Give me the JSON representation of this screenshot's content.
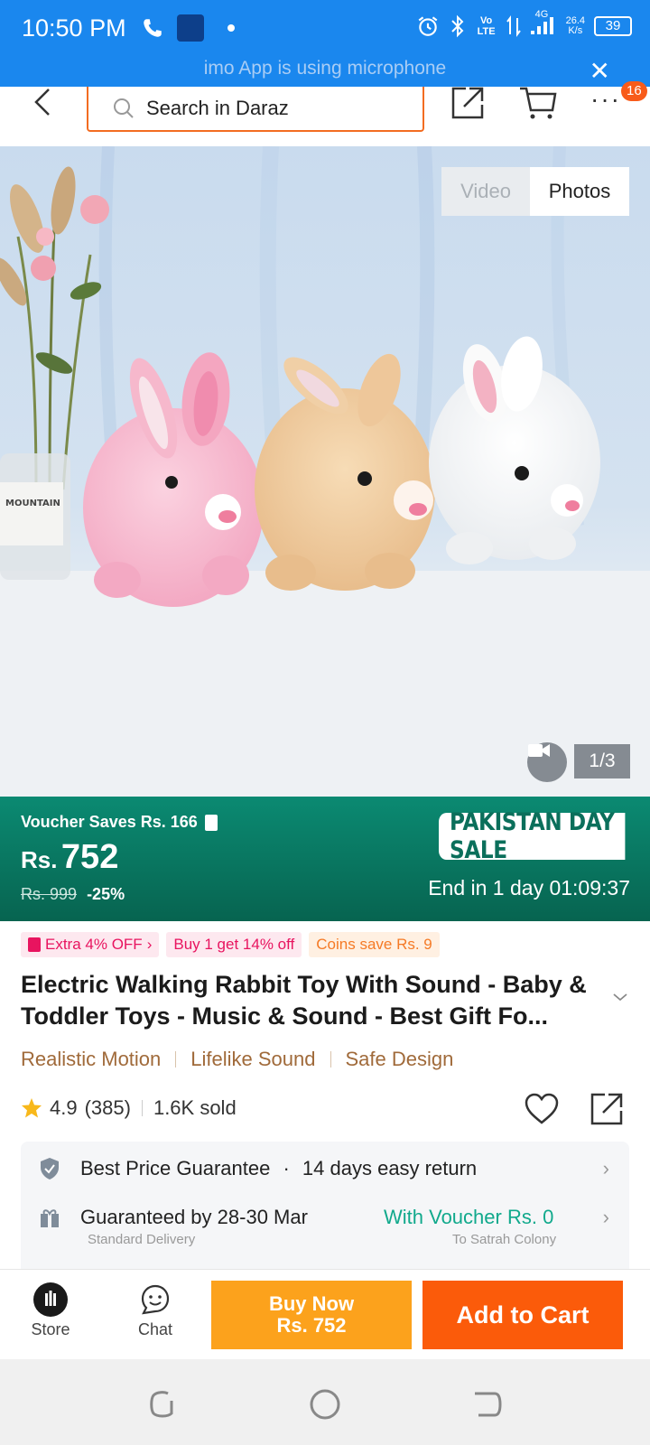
{
  "status_bar": {
    "time": "10:50 PM",
    "battery": "39",
    "network_speed_value": "26.4",
    "network_speed_unit": "K/s",
    "network_type": "4G",
    "volte": "Vo LTE",
    "notice": "imo App is using microphone"
  },
  "header": {
    "search_placeholder": "Search in Daraz",
    "notification_count": "16"
  },
  "gallery": {
    "video_label": "Video",
    "photos_label": "Photos",
    "counter": "1/3",
    "vase_label": "MOUNTAIN"
  },
  "banner": {
    "voucher_text": "Voucher Saves Rs. 166",
    "currency": "Rs.",
    "price": "752",
    "original_price": "Rs. 999",
    "discount": "-25%",
    "sale_name": "PAKISTAN DAY SALE",
    "end_text": "End in 1 day 01:09:37"
  },
  "promos": {
    "extra_off": "Extra 4% OFF",
    "buy_get": "Buy 1 get 14% off",
    "coins": "Coins save Rs. 9"
  },
  "product": {
    "title": "Electric Walking Rabbit Toy With Sound - Baby & Toddler Toys - Music & Sound - Best Gift Fo...",
    "features": [
      "Realistic Motion",
      "Lifelike Sound",
      "Safe Design"
    ],
    "rating": "4.9",
    "reviews": "(385)",
    "sold": "1.6K sold"
  },
  "info": {
    "guarantee": "Best Price Guarantee",
    "return_policy": "14 days easy return",
    "delivery": "Guaranteed by 28-30 Mar",
    "delivery_voucher": "With Voucher Rs. 0",
    "delivery_sub": "Standard Delivery",
    "location_sub": "To Satrah Colony"
  },
  "bottom_bar": {
    "store_label": "Store",
    "chat_label": "Chat",
    "buy_now_label": "Buy Now",
    "buy_now_price": "Rs. 752",
    "add_to_cart_label": "Add to Cart"
  },
  "colors": {
    "status_bar": "#1a87ee",
    "brand_orange": "#f36c21",
    "banner_green": "#0b8a72",
    "buy_now": "#fca21c",
    "add_to_cart": "#fb5b0a",
    "feature_brown": "#a06a3a",
    "voucher_green": "#11a98c"
  },
  "icons": [
    "back-icon",
    "search-icon",
    "share-icon",
    "cart-icon",
    "more-icon",
    "video-camera-icon",
    "star-icon",
    "heart-icon",
    "shield-icon",
    "gift-icon",
    "chevron-right-icon",
    "chevron-down-icon",
    "store-icon",
    "chat-icon",
    "alarm-icon",
    "bluetooth-icon",
    "signal-icon"
  ]
}
